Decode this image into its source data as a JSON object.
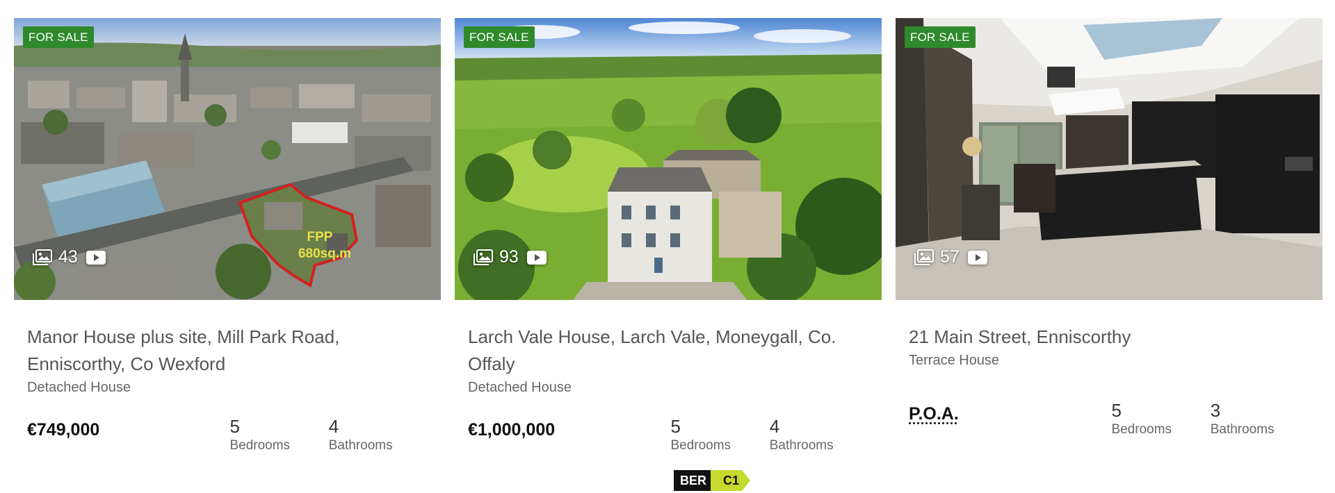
{
  "listings": [
    {
      "badge": "FOR SALE",
      "photo_count": "43",
      "title": "Manor House plus site, Mill Park Road, Enniscorthy, Co Wexford",
      "property_type": "Detached House",
      "price": "€749,000",
      "bedrooms": "5",
      "bedrooms_label": "Bedrooms",
      "bathrooms": "4",
      "bathrooms_label": "Bathrooms",
      "image_overlay_text_1": "FPP",
      "image_overlay_text_2": "680sq.m"
    },
    {
      "badge": "FOR SALE",
      "photo_count": "93",
      "title": "Larch Vale House, Larch Vale, Moneygall, Co. Offaly",
      "property_type": "Detached House",
      "price": "€1,000,000",
      "bedrooms": "5",
      "bedrooms_label": "Bedrooms",
      "bathrooms": "4",
      "bathrooms_label": "Bathrooms",
      "ber_label": "BER",
      "ber_rating": "C1"
    },
    {
      "badge": "FOR SALE",
      "photo_count": "57",
      "title": "21 Main Street, Enniscorthy",
      "property_type": "Terrace House",
      "price": "P.O.A.",
      "bedrooms": "5",
      "bedrooms_label": "Bedrooms",
      "bathrooms": "3",
      "bathrooms_label": "Bathrooms"
    }
  ],
  "colors": {
    "badge_green": "#2f8a2b",
    "ber_c1": "#c6d92e",
    "outline_red": "#d42020"
  },
  "icons": {
    "gallery": "gallery-icon",
    "video": "video-play-icon"
  }
}
